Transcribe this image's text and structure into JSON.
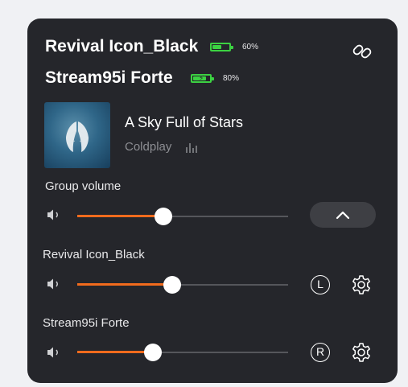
{
  "devices_header": [
    {
      "name": "Revival Icon_Black",
      "battery_percent_label": "60%",
      "battery_level": 0.6,
      "charging": false
    },
    {
      "name": "Stream95i Forte",
      "battery_percent_label": "80%",
      "battery_level": 0.8,
      "charging": true
    }
  ],
  "header": {
    "link_icon": "link-icon"
  },
  "now_playing": {
    "title": "A Sky Full of Stars",
    "artist": "Coldplay",
    "artwork": "album-art-wings",
    "indicator_icon": "equalizer-icon"
  },
  "group_volume": {
    "label": "Group volume",
    "level": 0.41,
    "collapse_icon": "chevron-up-icon"
  },
  "speakers": [
    {
      "label": "Revival Icon_Black",
      "level": 0.45,
      "channel": "L",
      "settings_icon": "gear-icon"
    },
    {
      "label": "Stream95i Forte",
      "level": 0.36,
      "channel": "R",
      "settings_icon": "gear-icon"
    }
  ],
  "colors": {
    "panel": "#25262b",
    "accent": "#f26b1d",
    "battery": "#3cd242",
    "secondary_text": "#8d8e93"
  }
}
